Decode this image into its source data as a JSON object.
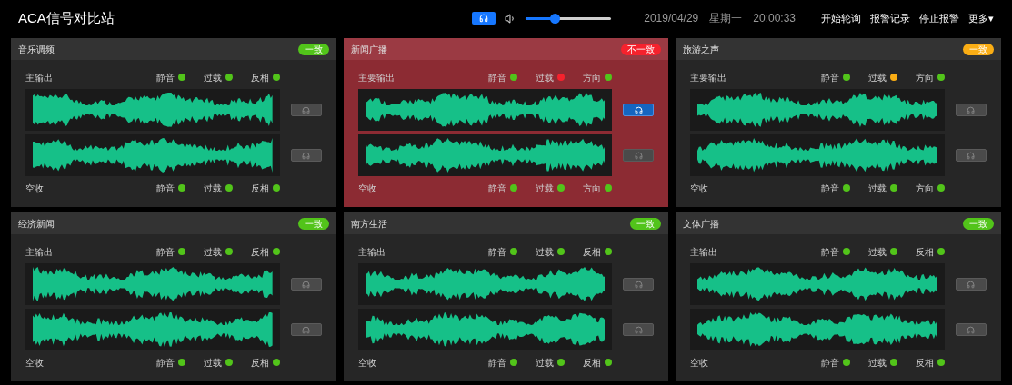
{
  "header": {
    "title": "ACA信号对比站",
    "monitor_button": {
      "selected": true
    },
    "volume": {
      "level": 0.34
    },
    "date": "2019/04/29",
    "weekday": "星期一",
    "time": "20:00:33",
    "menu": [
      "开始轮询",
      "报警记录",
      "停止报警",
      "更多▾"
    ]
  },
  "panels": [
    {
      "title": "音乐调频",
      "alert": false,
      "badge": {
        "text": "一致",
        "color": "#52c41a"
      },
      "channels": [
        {
          "label": "主输出",
          "listen_selected": false,
          "indicators": [
            {
              "label": "静音",
              "color": "#52c41a"
            },
            {
              "label": "过载",
              "color": "#52c41a"
            },
            {
              "label": "反相",
              "color": "#52c41a"
            }
          ]
        },
        {
          "label": "空收",
          "listen_selected": false,
          "indicators": [
            {
              "label": "静音",
              "color": "#52c41a"
            },
            {
              "label": "过载",
              "color": "#52c41a"
            },
            {
              "label": "反相",
              "color": "#52c41a"
            }
          ]
        }
      ]
    },
    {
      "title": "新闻广播",
      "alert": true,
      "badge": {
        "text": "不一致",
        "color": "#f5222d"
      },
      "channels": [
        {
          "label": "主要输出",
          "listen_selected": true,
          "indicators": [
            {
              "label": "静音",
              "color": "#52c41a"
            },
            {
              "label": "过载",
              "color": "#f5222d"
            },
            {
              "label": "方向",
              "color": "#52c41a"
            }
          ]
        },
        {
          "label": "空收",
          "listen_selected": false,
          "indicators": [
            {
              "label": "静音",
              "color": "#52c41a"
            },
            {
              "label": "过载",
              "color": "#52c41a"
            },
            {
              "label": "方向",
              "color": "#52c41a"
            }
          ]
        }
      ]
    },
    {
      "title": "旅游之声",
      "alert": false,
      "badge": {
        "text": "一致",
        "color": "#faad14"
      },
      "channels": [
        {
          "label": "主要输出",
          "listen_selected": false,
          "indicators": [
            {
              "label": "静音",
              "color": "#52c41a"
            },
            {
              "label": "过载",
              "color": "#faad14"
            },
            {
              "label": "方向",
              "color": "#52c41a"
            }
          ]
        },
        {
          "label": "空收",
          "listen_selected": false,
          "indicators": [
            {
              "label": "静音",
              "color": "#52c41a"
            },
            {
              "label": "过载",
              "color": "#52c41a"
            },
            {
              "label": "方向",
              "color": "#52c41a"
            }
          ]
        }
      ]
    },
    {
      "title": "经济新闻",
      "alert": false,
      "badge": {
        "text": "一致",
        "color": "#52c41a"
      },
      "channels": [
        {
          "label": "主输出",
          "listen_selected": false,
          "indicators": [
            {
              "label": "静音",
              "color": "#52c41a"
            },
            {
              "label": "过载",
              "color": "#52c41a"
            },
            {
              "label": "反相",
              "color": "#52c41a"
            }
          ]
        },
        {
          "label": "空收",
          "listen_selected": false,
          "indicators": [
            {
              "label": "静音",
              "color": "#52c41a"
            },
            {
              "label": "过载",
              "color": "#52c41a"
            },
            {
              "label": "反相",
              "color": "#52c41a"
            }
          ]
        }
      ]
    },
    {
      "title": "南方生活",
      "alert": false,
      "badge": {
        "text": "一致",
        "color": "#52c41a"
      },
      "channels": [
        {
          "label": "主输出",
          "listen_selected": false,
          "indicators": [
            {
              "label": "静音",
              "color": "#52c41a"
            },
            {
              "label": "过载",
              "color": "#52c41a"
            },
            {
              "label": "反相",
              "color": "#52c41a"
            }
          ]
        },
        {
          "label": "空收",
          "listen_selected": false,
          "indicators": [
            {
              "label": "静音",
              "color": "#52c41a"
            },
            {
              "label": "过载",
              "color": "#52c41a"
            },
            {
              "label": "反相",
              "color": "#52c41a"
            }
          ]
        }
      ]
    },
    {
      "title": "文体广播",
      "alert": false,
      "badge": {
        "text": "一致",
        "color": "#52c41a"
      },
      "channels": [
        {
          "label": "主输出",
          "listen_selected": false,
          "indicators": [
            {
              "label": "静音",
              "color": "#52c41a"
            },
            {
              "label": "过载",
              "color": "#52c41a"
            },
            {
              "label": "反相",
              "color": "#52c41a"
            }
          ]
        },
        {
          "label": "空收",
          "listen_selected": false,
          "indicators": [
            {
              "label": "静音",
              "color": "#52c41a"
            },
            {
              "label": "过载",
              "color": "#52c41a"
            },
            {
              "label": "反相",
              "color": "#52c41a"
            }
          ]
        }
      ]
    }
  ]
}
